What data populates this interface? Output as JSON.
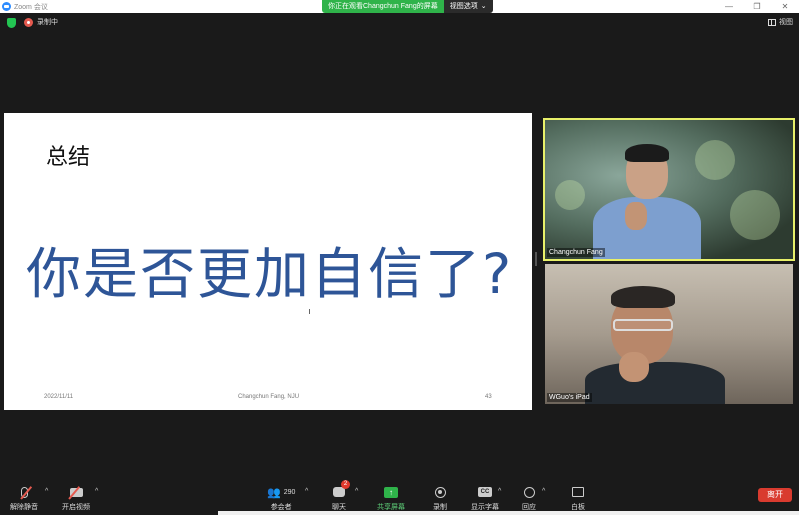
{
  "window": {
    "title": "Zoom 会议",
    "controls": [
      "—",
      "❐",
      "✕"
    ]
  },
  "share_banner": {
    "viewing_text": "你正在观看Changchun Fang的屏幕",
    "view_options_label": "视图选项",
    "view_options_caret": "⌄"
  },
  "status_bar": {
    "recording_label": "录制中",
    "view_label": "视图"
  },
  "slide": {
    "title": "总结",
    "question": "你是否更加自信了?",
    "footer_date": "2022/11/11",
    "footer_author": "Changchun Fang, NJU",
    "footer_page": "43"
  },
  "participants": [
    {
      "name": "Changchun Fang",
      "active_speaker": true
    },
    {
      "name": "WGuo's iPad",
      "active_speaker": false
    }
  ],
  "toolbar": {
    "unmute_label": "解除静音",
    "start_video_label": "开启视频",
    "participants_label": "参会者",
    "participants_count": "290",
    "chat_label": "聊天",
    "chat_badge": "2",
    "share_label": "共享屏幕",
    "record_label": "录制",
    "captions_label": "显示字幕",
    "captions_icon_text": "CC",
    "reactions_label": "回应",
    "whiteboard_label": "白板",
    "leave_label": "离开",
    "caret": "^"
  },
  "colors": {
    "share_green": "#2fb34a",
    "speaker_border": "#e8f06a",
    "leave_red": "#d93b2f",
    "slide_text_blue": "#2e5597"
  }
}
